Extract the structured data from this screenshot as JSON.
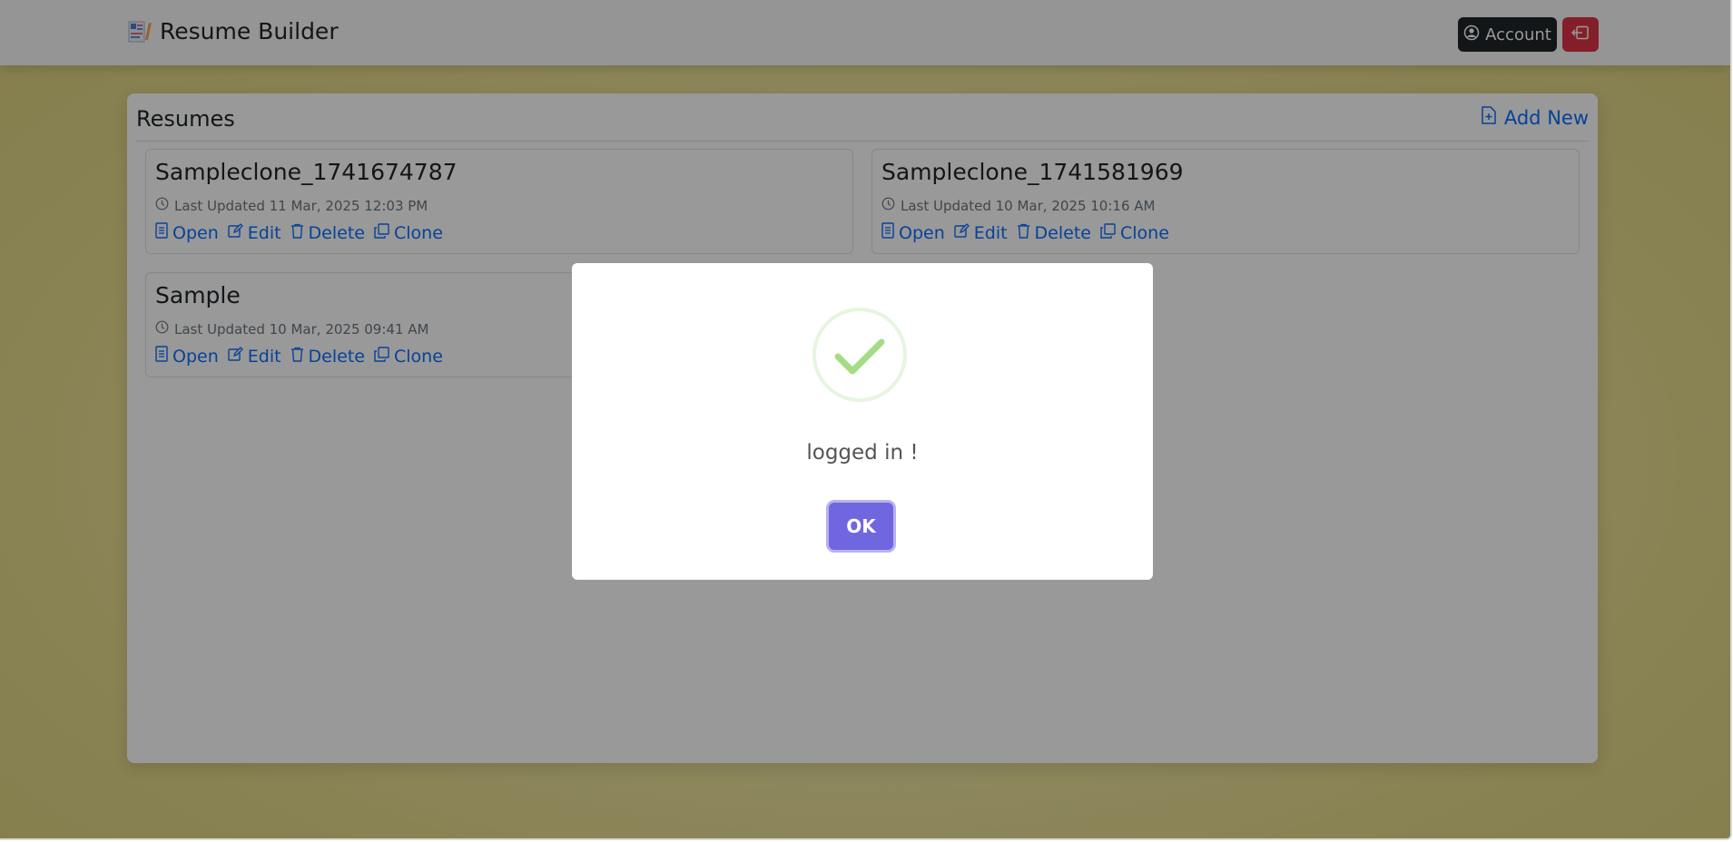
{
  "app": {
    "title": "Resume Builder"
  },
  "header": {
    "account_label": "Account"
  },
  "resumes": {
    "title": "Resumes",
    "add_new_label": "Add New",
    "items": [
      {
        "name": "Sampleclone_1741674787",
        "updated": "Last Updated 11 Mar, 2025 12:03 PM",
        "actions": [
          "Open",
          "Edit",
          "Delete",
          "Clone"
        ]
      },
      {
        "name": "Sampleclone_1741581969",
        "updated": "Last Updated 10 Mar, 2025 10:16 AM",
        "actions": [
          "Open",
          "Edit",
          "Delete",
          "Clone"
        ]
      },
      {
        "name": "Sample",
        "updated": "Last Updated 10 Mar, 2025 09:41 AM",
        "actions": [
          "Open",
          "Edit",
          "Delete",
          "Clone"
        ]
      }
    ]
  },
  "modal": {
    "message": "logged in !",
    "ok_label": "OK"
  },
  "colors": {
    "accent": "#0d6efd",
    "danger": "#dc3545",
    "ok_button": "#7066e0",
    "success": "#a5dc86"
  }
}
